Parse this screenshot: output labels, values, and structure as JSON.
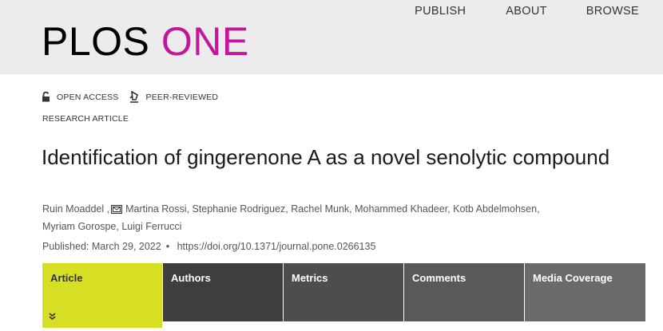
{
  "header": {
    "logo_left": "PLOS",
    "logo_right": "ONE",
    "nav": [
      "PUBLISH",
      "ABOUT",
      "BROWSE"
    ]
  },
  "badges": {
    "open_access": "OPEN ACCESS",
    "peer_reviewed": "PEER-REVIEWED"
  },
  "article_type": "RESEARCH ARTICLE",
  "title": "Identification of gingerenone A as a novel senolytic compound",
  "authors": [
    "Ruin Moaddel",
    "Martina Rossi",
    "Stephanie Rodriguez",
    "Rachel Munk",
    "Mohammed Khadeer",
    "Kotb Abdelmohsen",
    "Myriam Gorospe",
    "Luigi Ferrucci"
  ],
  "published": {
    "label": "Published: March 29, 2022",
    "doi": "https://doi.org/10.1371/journal.pone.0266135"
  },
  "tabs": [
    "Article",
    "Authors",
    "Metrics",
    "Comments",
    "Media Coverage"
  ],
  "colors": {
    "brand_magenta": "#c4169c",
    "active_tab": "#d6df23",
    "header_bg": "#ececec"
  }
}
